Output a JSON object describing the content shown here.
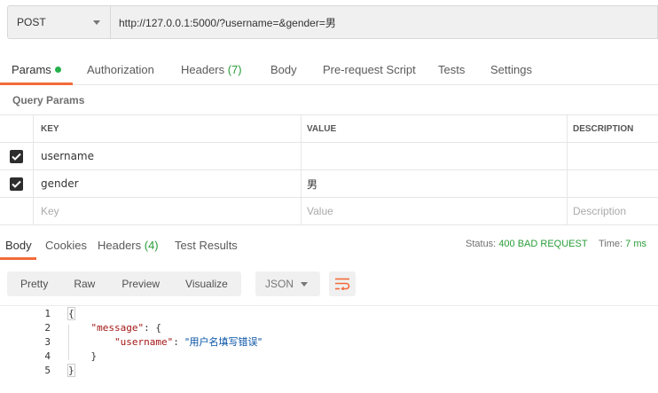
{
  "request": {
    "method": "POST",
    "url": "http://127.0.0.1:5000/?username=&gender=男"
  },
  "request_tabs": [
    {
      "label": "Params",
      "count": ""
    },
    {
      "label": "Authorization",
      "count": ""
    },
    {
      "label": "Headers ",
      "count": "(7)"
    },
    {
      "label": "Body",
      "count": ""
    },
    {
      "label": "Pre-request Script",
      "count": ""
    },
    {
      "label": "Tests",
      "count": ""
    },
    {
      "label": "Settings",
      "count": ""
    }
  ],
  "query_params": {
    "title": "Query Params",
    "headers": {
      "key": "KEY",
      "value": "VALUE",
      "description": "DESCRIPTION"
    },
    "rows": [
      {
        "key": "username",
        "value": "",
        "description": "",
        "checked": true
      },
      {
        "key": "gender",
        "value": "男",
        "description": "",
        "checked": true
      }
    ],
    "placeholders": {
      "key": "Key",
      "value": "Value",
      "description": "Description"
    }
  },
  "response_tabs": [
    {
      "label": "Body",
      "count": ""
    },
    {
      "label": "Cookies",
      "count": ""
    },
    {
      "label": "Headers ",
      "count": "(4)"
    },
    {
      "label": "Test Results",
      "count": ""
    }
  ],
  "response_status": {
    "status_label": "Status:",
    "status_value": "400 BAD REQUEST",
    "time_label": "Time:",
    "time_value": "7 ms"
  },
  "body_toolbar": {
    "views": [
      "Pretty",
      "Raw",
      "Preview",
      "Visualize"
    ],
    "format": "JSON"
  },
  "response_body": {
    "line_numbers": [
      "1",
      "2",
      "3",
      "4",
      "5"
    ],
    "open_brace": "{",
    "message_key": "\"message\"",
    "colon_open": ": {",
    "username_key": "\"username\"",
    "colon": ": ",
    "username_value": "\"用户名填写错误\"",
    "inner_close": "}",
    "close_brace": "}"
  },
  "colors": {
    "accent": "#f26b3a",
    "success_green": "#2a9d3a",
    "active_dot": "#26b14b"
  }
}
